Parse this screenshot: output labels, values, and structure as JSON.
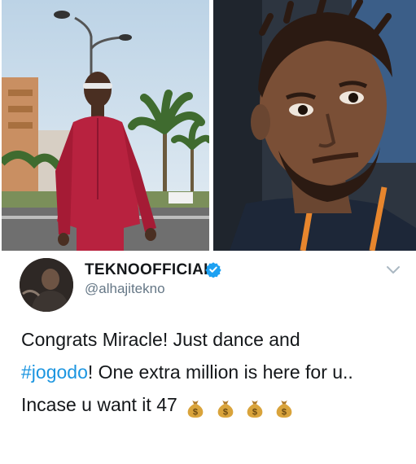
{
  "tweet": {
    "display_name": "TEKNOOFFICIAL",
    "handle": "@alhajitekno",
    "text_part1": "Congrats Miracle! Just dance and",
    "hashtag": "#jogodo",
    "text_part2": "! One extra million is here for u..",
    "text_part3": "Incase u want it 47",
    "emoji": [
      "money-bag",
      "money-bag",
      "money-bag",
      "money-bag"
    ]
  },
  "colors": {
    "hashtag": "#1b95e0",
    "verified": "#1da1f2",
    "handle": "#657786",
    "text": "#14171a"
  }
}
